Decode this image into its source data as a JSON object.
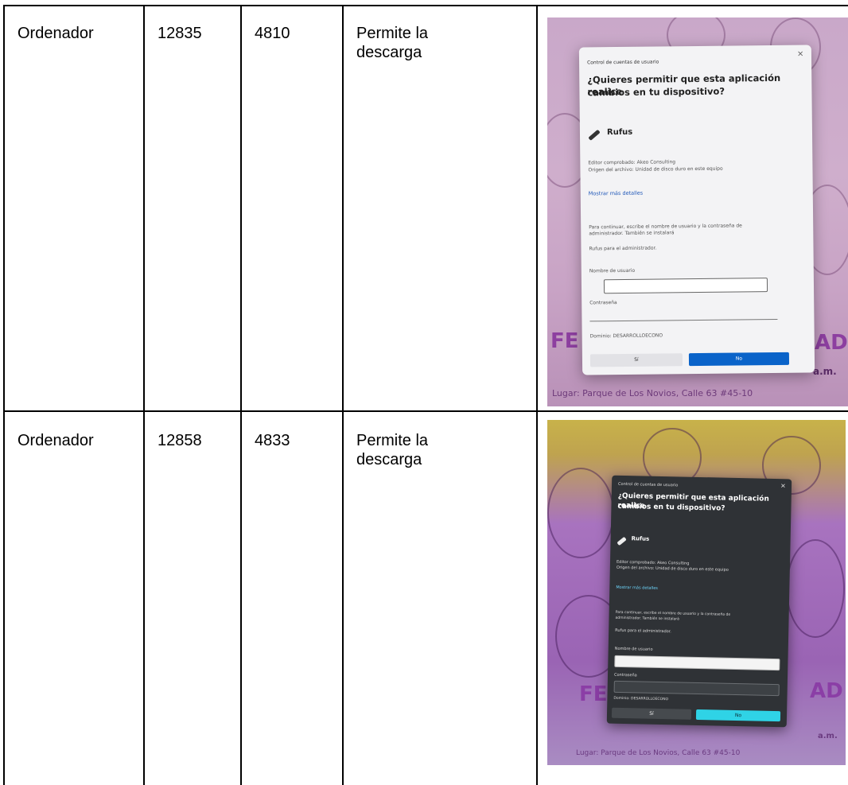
{
  "rows": [
    {
      "device": "Ordenador",
      "col2": "12835",
      "col3": "4810",
      "result_line1": "Permite la",
      "result_line2": "descarga",
      "photo": {
        "dialog_header": "Control de cuentas de usuario",
        "question_line1": "¿Quieres permitir que esta aplicación realice",
        "question_line2": "cambios en tu dispositivo?",
        "app_name": "Rufus",
        "publisher": "Editor comprobado: Akeo Consulting",
        "origin": "Origen del archivo: Unidad de disco duro en este equipo",
        "details_link": "Mostrar más detalles",
        "instructions_line1": "Para continuar, escribe el nombre de usuario y la contraseña de",
        "instructions_line2": "administrador. También se instalará",
        "admin_note": "Rufus para el administrador.",
        "username_label": "Nombre de usuario",
        "password_label": "Contraseña",
        "domain": "Dominio: DESARROLLOECONO",
        "yes_button": "Sí",
        "no_button": "No",
        "poster_text_1": "FE",
        "poster_text_2": "AD",
        "poster_place": "Lugar: Parque de Los Novios, Calle 63 #45-10",
        "poster_time": "a.m."
      }
    },
    {
      "device": "Ordenador",
      "col2": "12858",
      "col3": "4833",
      "result_line1": "Permite la",
      "result_line2": "descarga",
      "photo": {
        "dialog_header": "Control de cuentas de usuario",
        "question_line1": "¿Quieres permitir que esta aplicación realice",
        "question_line2": "cambios en tu dispositivo?",
        "app_name": "Rufus",
        "publisher": "Editor comprobado: Akeo Consulting",
        "origin": "Origen del archivo: Unidad de disco duro en este equipo",
        "details_link": "Mostrar más detalles",
        "instructions_line1": "Para continuar, escribe el nombre de usuario y la contraseña de",
        "instructions_line2": "administrador. También se instalará",
        "admin_note": "Rufus para el administrador.",
        "username_label": "Nombre de usuario",
        "password_label": "Contraseña",
        "domain": "Dominio: DESARROLLOECONO",
        "yes_button": "Sí",
        "no_button": "No",
        "poster_text_1": "FE",
        "poster_text_2": "AD",
        "poster_place": "Lugar: Parque de Los Novios, Calle 63 #45-10",
        "poster_time": "a.m."
      }
    }
  ],
  "colors": {
    "border": "#000000",
    "dialog_light_bg": "#f3f3f5",
    "dialog_dark_bg": "#2f3236",
    "accent_blue": "#0a63c9",
    "accent_cyan": "#2fd3e6"
  }
}
